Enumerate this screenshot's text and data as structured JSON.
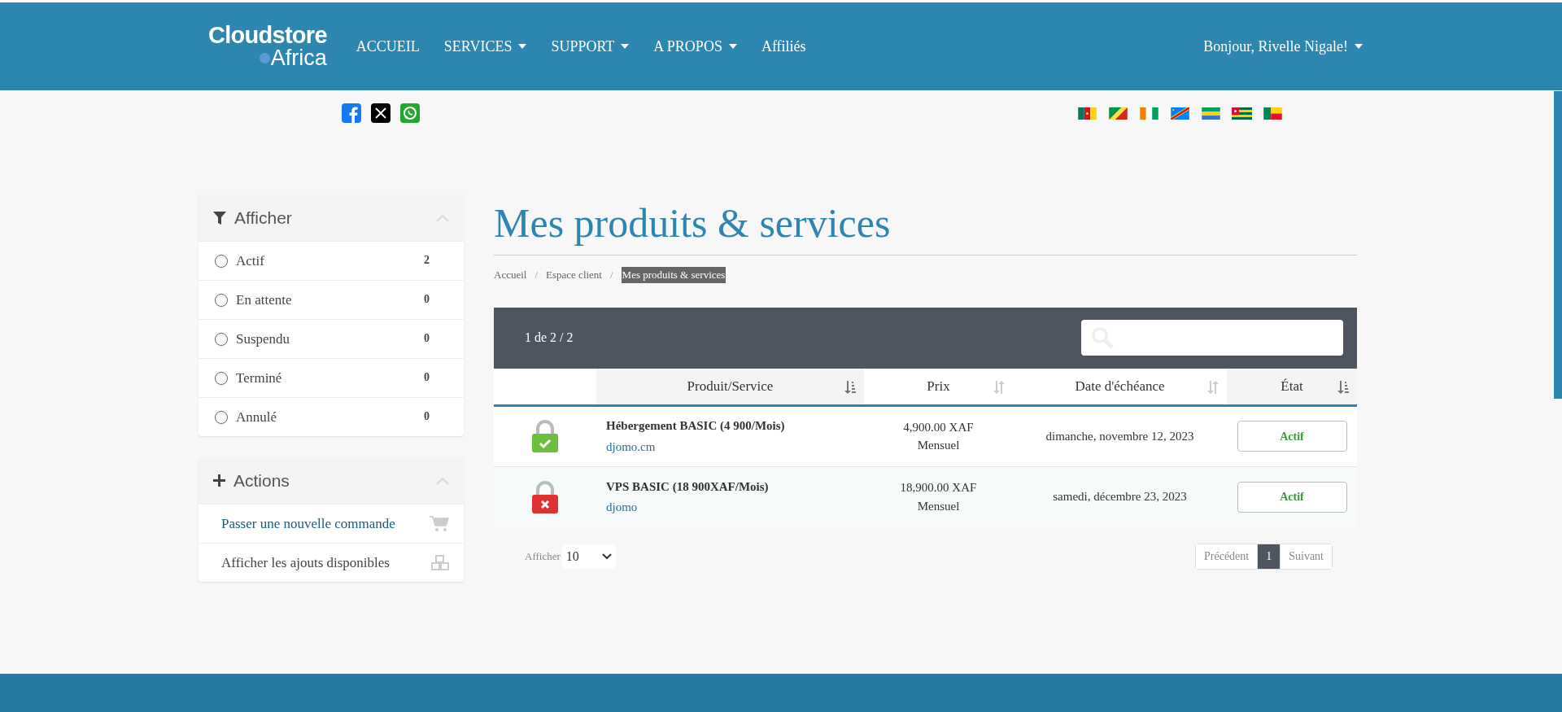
{
  "logo": {
    "line1": "Cloudstore",
    "line2": "Africa"
  },
  "nav": [
    {
      "label": "ACCUEIL",
      "dropdown": false
    },
    {
      "label": "SERVICES",
      "dropdown": true
    },
    {
      "label": "SUPPORT",
      "dropdown": true
    },
    {
      "label": "A PROPOS",
      "dropdown": true
    },
    {
      "label": "Affiliés",
      "dropdown": false
    }
  ],
  "user_menu": {
    "label": "Bonjour, Rivelle Nigale!",
    "dropdown": true
  },
  "filter_panel": {
    "title": "Afficher",
    "items": [
      {
        "label": "Actif",
        "count": "2",
        "selected": false
      },
      {
        "label": "En attente",
        "count": "0",
        "selected": false
      },
      {
        "label": "Suspendu",
        "count": "0",
        "selected": false
      },
      {
        "label": "Terminé",
        "count": "0",
        "selected": false
      },
      {
        "label": "Annulé",
        "count": "0",
        "selected": false
      }
    ]
  },
  "actions_panel": {
    "title": "Actions",
    "items": [
      {
        "label": "Passer une nouvelle commande",
        "kind": "cart",
        "link": true
      },
      {
        "label": "Afficher les ajouts disponibles",
        "kind": "cubes",
        "link": false
      }
    ]
  },
  "page_title": "Mes produits & services",
  "breadcrumb_separator": "/",
  "breadcrumb": [
    {
      "label": "Accueil",
      "selected": false
    },
    {
      "label": "Espace client",
      "selected": false
    },
    {
      "label": "Mes produits & services",
      "selected": true
    }
  ],
  "table": {
    "info": "1 de 2 / 2",
    "columns": [
      {
        "label": "Produit/Service",
        "sorted": true
      },
      {
        "label": "Prix",
        "sorted": false
      },
      {
        "label": "Date d'échéance",
        "sorted": false
      },
      {
        "label": "État",
        "sorted": true
      }
    ],
    "rows": [
      {
        "kind": "valid",
        "product": "Hébergement BASIC (4 900/Mois)",
        "domain": "djomo.cm",
        "price": "4,900.00 XAF",
        "cycle": "Mensuel",
        "due": "dimanche, novembre 12, 2023",
        "status": "Actif"
      },
      {
        "kind": "invalid",
        "product": "VPS BASIC (18 900XAF/Mois)",
        "domain": "djomo",
        "price": "18,900.00 XAF",
        "cycle": "Mensuel",
        "due": "samedi, décembre 23, 2023",
        "status": "Actif"
      }
    ]
  },
  "page_length": {
    "label": "Afficher",
    "value": "10"
  },
  "pagination": [
    {
      "label": "Précédent",
      "selected": false
    },
    {
      "label": "1",
      "selected": true
    },
    {
      "label": "Suivant",
      "selected": false
    }
  ]
}
